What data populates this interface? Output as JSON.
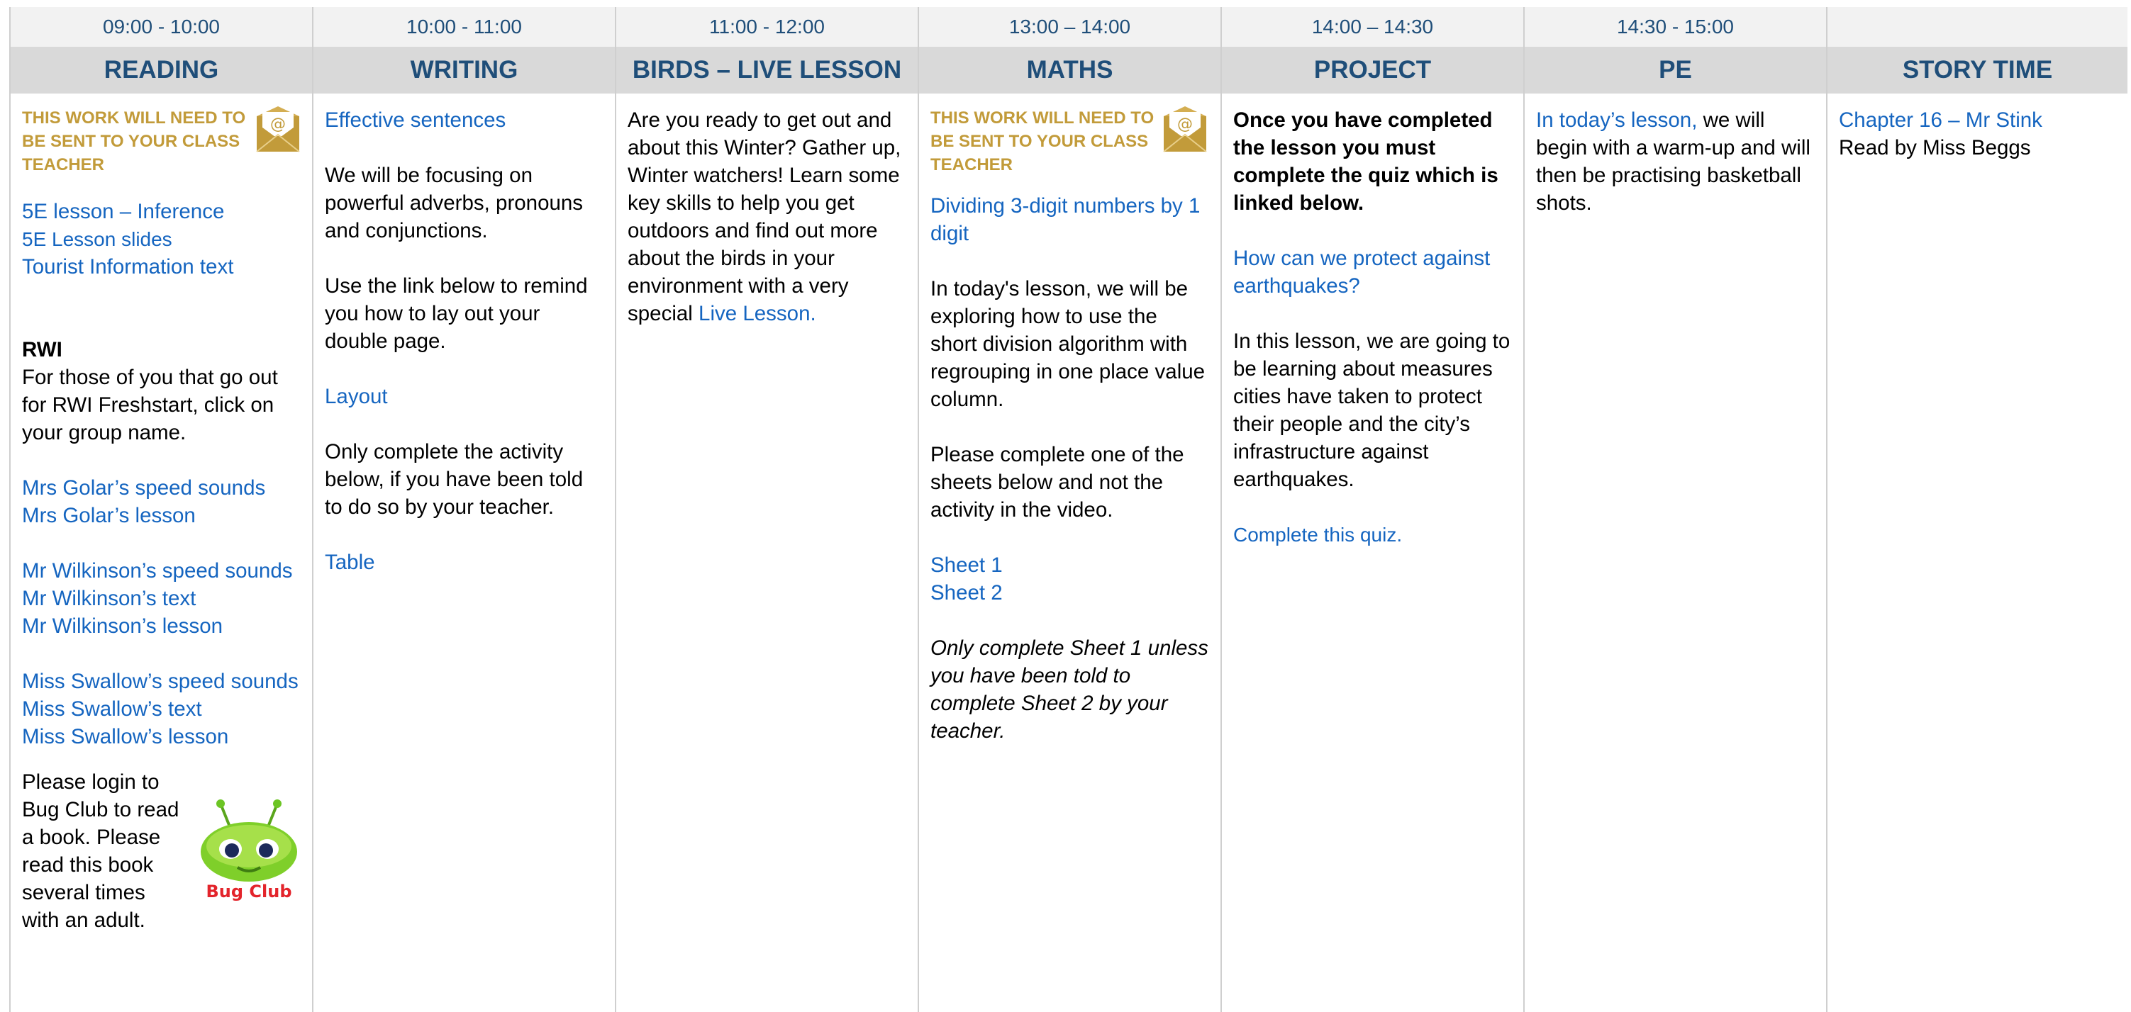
{
  "columns": [
    {
      "time": "09:00 - 10:00",
      "subject": "READING"
    },
    {
      "time": "10:00 - 11:00",
      "subject": "WRITING"
    },
    {
      "time": "11:00 - 12:00",
      "subject": "BIRDS – LIVE LESSON"
    },
    {
      "time": "13:00 – 14:00",
      "subject": "MATHS"
    },
    {
      "time": "14:00 – 14:30",
      "subject": "PROJECT"
    },
    {
      "time": "14:30 - 15:00",
      "subject": "PE"
    },
    {
      "time": "",
      "subject": "STORY TIME"
    }
  ],
  "reading": {
    "notice": [
      "THIS WORK WILL NEED TO",
      "BE SENT TO YOUR CLASS",
      "TEACHER"
    ],
    "links1": [
      "5E lesson – Inference",
      "5E Lesson slides",
      "Tourist Information text"
    ],
    "rwi_title": "RWI",
    "rwi_text": [
      "For those of you that go out",
      "for RWI Freshstart, click on",
      "your group name."
    ],
    "group1": [
      "Mrs Golar’s speed sounds",
      "Mrs Golar’s lesson"
    ],
    "group2": [
      "Mr Wilkinson’s speed sounds",
      "Mr Wilkinson’s text",
      "Mr Wilkinson’s lesson"
    ],
    "group3": [
      "Miss Swallow’s speed sounds",
      "Miss Swallow’s text",
      "Miss Swallow’s lesson"
    ],
    "bug_text": [
      "Please login to",
      "Bug Club to read",
      "a book. Please",
      "read this book",
      "several times",
      "with an adult."
    ],
    "bug_logo_text": "Bug Club"
  },
  "writing": {
    "link1": "Effective sentences",
    "text1": [
      "We will be focusing on",
      "powerful adverbs, pronouns",
      "and conjunctions."
    ],
    "text2": [
      "Use the link below to remind",
      "you how to lay out your",
      "double page."
    ],
    "link2": "Layout",
    "text3": [
      "Only complete the activity",
      "below, if you have been told",
      "to do so by your teacher."
    ],
    "link3": "Table"
  },
  "birds": {
    "text": [
      "Are you ready to get out and",
      "about this Winter? Gather up,",
      "Winter watchers! Learn some",
      "key skills to help you get",
      "outdoors and find out more",
      "about the birds in your",
      "environment with a very"
    ],
    "last_prefix": "special ",
    "last_link": "Live Lesson."
  },
  "maths": {
    "notice": [
      "THIS WORK WILL NEED TO",
      "BE SENT TO YOUR CLASS",
      "TEACHER"
    ],
    "link1": [
      "Dividing 3-digit numbers by 1",
      "digit"
    ],
    "text1": [
      "In today's lesson, we will be",
      "exploring how to use the",
      "short division algorithm with",
      "regrouping in one place value",
      "column."
    ],
    "text2": [
      "Please complete one of the",
      "sheets below and not the",
      "activity in the video."
    ],
    "sheets": [
      "Sheet 1",
      "Sheet 2"
    ],
    "italic": [
      "Only complete Sheet 1 unless",
      "you have been told to",
      "complete Sheet 2 by your",
      "teacher."
    ]
  },
  "project": {
    "bold": [
      "Once you have completed",
      "the lesson you must",
      "complete the quiz which is",
      "linked below."
    ],
    "link1": [
      "How can we protect against",
      "earthquakes?"
    ],
    "text": [
      "In this lesson, we are going to",
      "be learning about measures",
      "cities have taken to protect",
      "their people and the city’s",
      "infrastructure against",
      "earthquakes."
    ],
    "quiz": "Complete this quiz."
  },
  "pe": {
    "link": "In today’s lesson,",
    "first_rest": " we will",
    "text": [
      "begin with a warm-up and will",
      "then be practising basketball",
      "shots."
    ]
  },
  "story": {
    "link": "Chapter 16 – Mr Stink",
    "text": "Read by Miss Beggs"
  },
  "colors": {
    "header_text": "#1f4e79",
    "link": "#1565c0",
    "notice": "#c29b3a",
    "header_bg": "#d9d9d9",
    "time_bg": "#f2f2f2"
  }
}
